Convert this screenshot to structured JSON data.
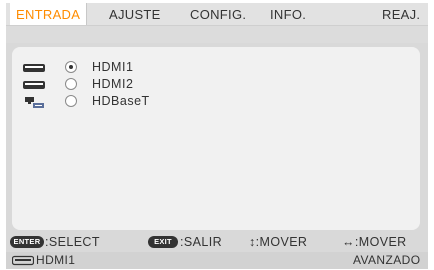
{
  "tabs": [
    {
      "label": "ENTRADA",
      "active": true
    },
    {
      "label": "AJUSTE",
      "active": false
    },
    {
      "label": "CONFIG.",
      "active": false
    },
    {
      "label": "INFO.",
      "active": false
    },
    {
      "label": "REAJ.",
      "active": false
    }
  ],
  "sources": [
    {
      "label": "HDMI1",
      "icon": "hdmi-port-icon",
      "selected": true
    },
    {
      "label": "HDMI2",
      "icon": "hdmi-port-icon",
      "selected": false
    },
    {
      "label": "HDBaseT",
      "icon": "network-devices-icon",
      "selected": false
    }
  ],
  "footer": {
    "enter_key": "ENTER",
    "enter_action": ":SELECT",
    "exit_key": "EXIT",
    "exit_action": ":SALIR",
    "updown_hint": "↕:MOVER",
    "leftright_hint": "↔:MOVER"
  },
  "status": {
    "current_input": "HDMI1",
    "current_input_icon": "hdmi-port-icon",
    "mode": "AVANZADO"
  },
  "colors": {
    "active_tab_text": "#ff8c00",
    "text": "#333333",
    "background": "#d9d9d9",
    "panel": "#f1f1f1"
  }
}
